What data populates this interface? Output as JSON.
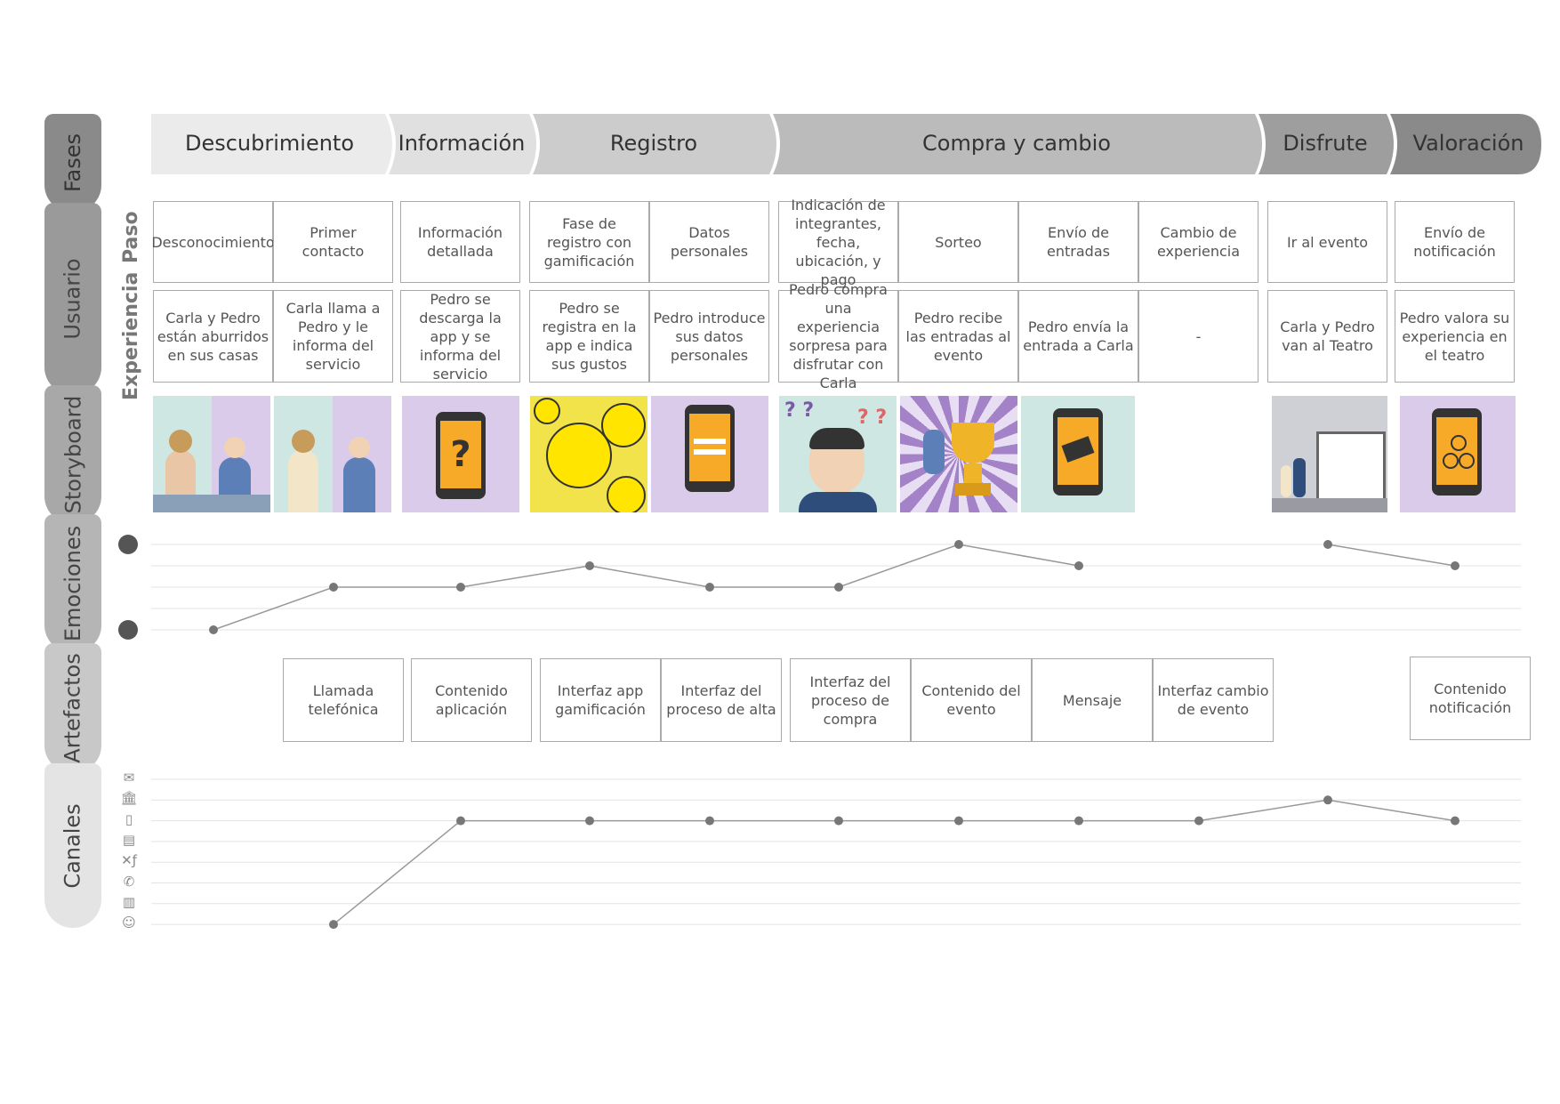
{
  "side_tabs": {
    "fases": "Fases",
    "usuario": "Usuario",
    "storyboard": "Storyboard",
    "emociones": "Emociones",
    "artefactos": "Artefactos",
    "canales": "Canales"
  },
  "row_labels": {
    "paso": "Paso",
    "experiencia": "Experiencia"
  },
  "phases": [
    {
      "label": "Descubrimiento"
    },
    {
      "label": "Información"
    },
    {
      "label": "Registro"
    },
    {
      "label": "Compra y cambio"
    },
    {
      "label": "Disfrute"
    },
    {
      "label": "Valoración"
    }
  ],
  "steps": [
    "Desconocimiento",
    "Primer contacto",
    "Información detallada",
    "Fase de registro con gamificación",
    "Datos personales",
    "Indicación de integrantes, fecha, ubicación, y pago",
    "Sorteo",
    "Envío de entradas",
    "Cambio de experiencia",
    "Ir al evento",
    "Envío de notificación"
  ],
  "experiences": [
    "Carla y Pedro están aburridos en sus casas",
    "Carla llama a Pedro y le informa del servicio",
    "Pedro se descarga la app y se informa del servicio",
    "Pedro se registra en la app e indica sus gustos",
    "Pedro introduce sus datos personales",
    "Pedro compra una experiencia sorpresa para disfrutar con Carla",
    "Pedro recibe las entradas al evento",
    "Pedro envía la entrada a Carla",
    "-",
    "Carla y Pedro van al Teatro",
    "Pedro valora su experiencia en el teatro"
  ],
  "storyboard": [
    {
      "scene": "bored-couple"
    },
    {
      "scene": "phone-call"
    },
    {
      "scene": "phone-question"
    },
    {
      "scene": "smileys"
    },
    {
      "scene": "phone-register"
    },
    {
      "scene": "confused-man"
    },
    {
      "scene": "trophy-winner"
    },
    {
      "scene": "phone-ticket"
    },
    {
      "scene": "none"
    },
    {
      "scene": "theatre-visit"
    },
    {
      "scene": "phone-rating"
    }
  ],
  "emotions": {
    "positive_icon": "happy-face-icon",
    "negative_icon": "sad-face-icon",
    "scale": "0 = sad, 4 = happy",
    "values": [
      0,
      2,
      2,
      3,
      2,
      2,
      4,
      3,
      null,
      4,
      3
    ]
  },
  "artifacts": [
    "",
    "Llamada telefónica",
    "Contenido aplicación",
    "Interfaz app gamificación",
    "Interfaz del proceso de alta",
    "Interfaz del proceso de compra",
    "Contenido del evento",
    "Mensaje",
    "Interfaz cambio de evento",
    "",
    "Contenido notificación"
  ],
  "channels": {
    "icons": [
      "mail-icon",
      "bank-icon",
      "mobile-icon",
      "newspaper-icon",
      "social-icon",
      "phone-icon",
      "outdoor-icon",
      "word-of-mouth-icon"
    ],
    "glyphs": [
      "✉",
      "🏛",
      "▯",
      "▤",
      "✕ƒ",
      "✆",
      "▥",
      "☺"
    ],
    "points": [
      {
        "step": 1,
        "channel": "word-of-mouth-icon"
      },
      {
        "step": 2,
        "channel": "mobile-icon"
      },
      {
        "step": 3,
        "channel": "mobile-icon"
      },
      {
        "step": 4,
        "channel": "mobile-icon"
      },
      {
        "step": 5,
        "channel": "mobile-icon"
      },
      {
        "step": 6,
        "channel": "mobile-icon"
      },
      {
        "step": 7,
        "channel": "mobile-icon"
      },
      {
        "step": 8,
        "channel": "mobile-icon"
      },
      {
        "step": 9,
        "channel": "bank-icon"
      },
      {
        "step": 10,
        "channel": "mobile-icon"
      }
    ]
  }
}
